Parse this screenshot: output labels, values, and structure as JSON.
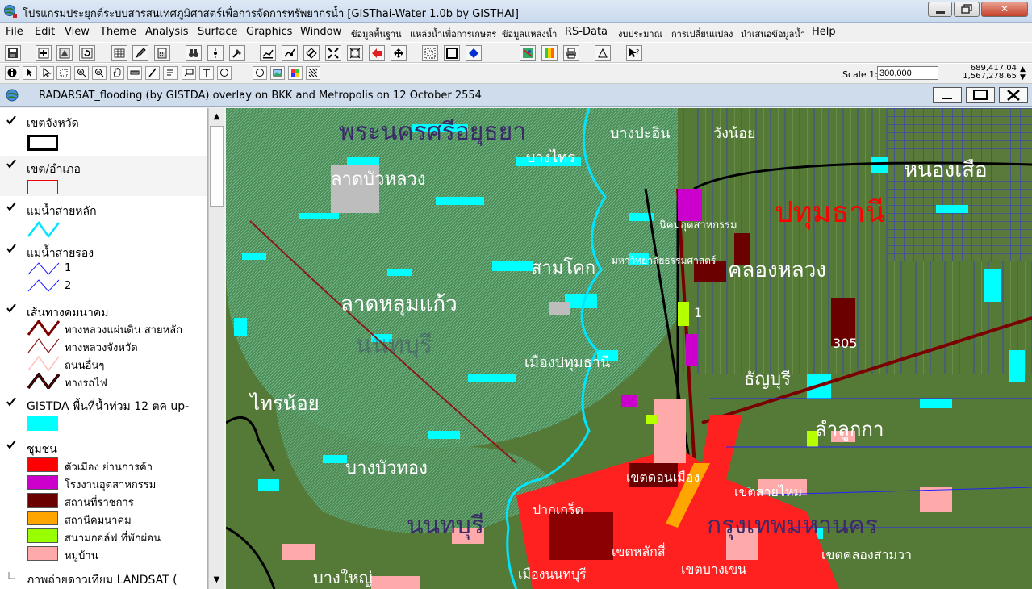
{
  "window": {
    "title": "โปรแกรมประยุกต์ระบบสารสนเทศภูมิศาสตร์เพื่อการจัดการทรัพยากรน้ำ  [GISThai-Water 1.0b   by GISTHAI]",
    "minimize_label": "",
    "maximize_label": "",
    "close_label": "✕"
  },
  "menu": [
    "File",
    "Edit",
    "View",
    "Theme",
    "Analysis",
    "Surface",
    "Graphics",
    "Window",
    "ข้อมูลพื้นฐาน",
    "แหล่งน้ำเพื่อการเกษตร",
    "ข้อมูลแหล่งน้ำ",
    "RS-Data",
    "งบประมาณ",
    "การเปลี่ยนแปลง",
    "นำเสนอข้อมูลน้ำ",
    "Help"
  ],
  "scale": {
    "label": "Scale 1:",
    "value": "300,000"
  },
  "coords": {
    "x": "689,417.04",
    "y": "1,567,278.65"
  },
  "document": {
    "title": "RADARSAT_flooding (by GISTDA) overlay on BKK and Metropolis on 12 October 2554"
  },
  "legend": {
    "layers": [
      {
        "name": "เขตจังหวัด",
        "checked": true
      },
      {
        "name": "เขต/อำเภอ",
        "checked": true
      },
      {
        "name": "แม่น้ำสายหลัก",
        "checked": true
      },
      {
        "name": "แม่น้ำสายรอง",
        "checked": true,
        "items": [
          "1",
          "2"
        ]
      },
      {
        "name": "เส้นทางคมนาคม",
        "checked": true,
        "items": [
          "ทางหลวงแผ่นดิน สายหลัก",
          "ทางหลวงจังหวัด",
          "ถนนอื่นๆ",
          "ทางรถไฟ"
        ]
      },
      {
        "name": "GISTDA พื้นที่น้ำท่วม 12 ตค up-",
        "checked": true
      },
      {
        "name": "ชุมชน",
        "checked": true,
        "items": [
          "ตัวเมือง ย่านการค้า",
          "โรงงานอุตสาหกรรม",
          "สถานที่ราชการ",
          "สถานีคมนาคม",
          "สนามกอล์ฟ ที่พักผ่อน",
          "หมู่บ้าน"
        ]
      },
      {
        "name": "ภาพถ่ายดาวเทียม LANDSAT  (",
        "checked": false
      }
    ],
    "colors": {
      "province": "#000000",
      "district": "#ff0000",
      "main_river": "#00e5ff",
      "secondary_river": "#1a1aff",
      "flood": "#00ffff",
      "town": "#ff0000",
      "factory": "#cc00cc",
      "government": "#6b0000",
      "transport": "#ffa500",
      "golf": "#99ff00",
      "village": "#ffaaaa"
    }
  },
  "map": {
    "labels": [
      {
        "text": "พระนครศรีอยุธยา",
        "color": "#3a2a6a",
        "size": 30
      },
      {
        "text": "บางปะอิน",
        "color": "#ffffff",
        "size": 18
      },
      {
        "text": "วังน้อย",
        "color": "#ffffff",
        "size": 18
      },
      {
        "text": "บางไทร",
        "color": "#ffffff",
        "size": 18
      },
      {
        "text": "หนองเสือ",
        "color": "#ffffff",
        "size": 26
      },
      {
        "text": "ลาดบัวหลวง",
        "color": "#ffffff",
        "size": 22
      },
      {
        "text": "ปทุมธานี",
        "color": "#ff0000",
        "size": 36
      },
      {
        "text": "นิคมอุตสาหกรรม",
        "color": "#ffffff",
        "size": 13
      },
      {
        "text": "สามโคก",
        "color": "#ffffff",
        "size": 22
      },
      {
        "text": "มหาวิทยาลัยธรรมศาสตร์",
        "color": "#ffffff",
        "size": 12
      },
      {
        "text": "คลองหลวง",
        "color": "#ffffff",
        "size": 26
      },
      {
        "text": "ลาดหลุมแก้ว",
        "color": "#ffffff",
        "size": 26
      },
      {
        "text": "นนทบุรี",
        "color": "#3a2a6a",
        "size": 30
      },
      {
        "text": "305",
        "color": "#ffffff",
        "size": 16
      },
      {
        "text": "1",
        "color": "#ffffff",
        "size": 16
      },
      {
        "text": "เมืองปทุมธานี",
        "color": "#ffffff",
        "size": 18
      },
      {
        "text": "ธัญบุรี",
        "color": "#ffffff",
        "size": 22
      },
      {
        "text": "ไทรน้อย",
        "color": "#ffffff",
        "size": 24
      },
      {
        "text": "ลำลูกกา",
        "color": "#ffffff",
        "size": 24
      },
      {
        "text": "บางบัวทอง",
        "color": "#ffffff",
        "size": 22
      },
      {
        "text": "เขตดอนเมือง",
        "color": "#ffffff",
        "size": 16
      },
      {
        "text": "เขตสายไหม",
        "color": "#ffffff",
        "size": 16
      },
      {
        "text": "ปากเกร็ด",
        "color": "#ffffff",
        "size": 16
      },
      {
        "text": "กรุงเทพมหานคร",
        "color": "#3a2a6a",
        "size": 30
      },
      {
        "text": "เขตหลักสี่",
        "color": "#ffffff",
        "size": 16
      },
      {
        "text": "เขตคลองสามวา",
        "color": "#ffffff",
        "size": 16
      },
      {
        "text": "บางใหญ่",
        "color": "#ffffff",
        "size": 20
      },
      {
        "text": "เมืองนนทบุรี",
        "color": "#ffffff",
        "size": 16
      },
      {
        "text": "เขตบางเขน",
        "color": "#ffffff",
        "size": 16
      }
    ]
  }
}
